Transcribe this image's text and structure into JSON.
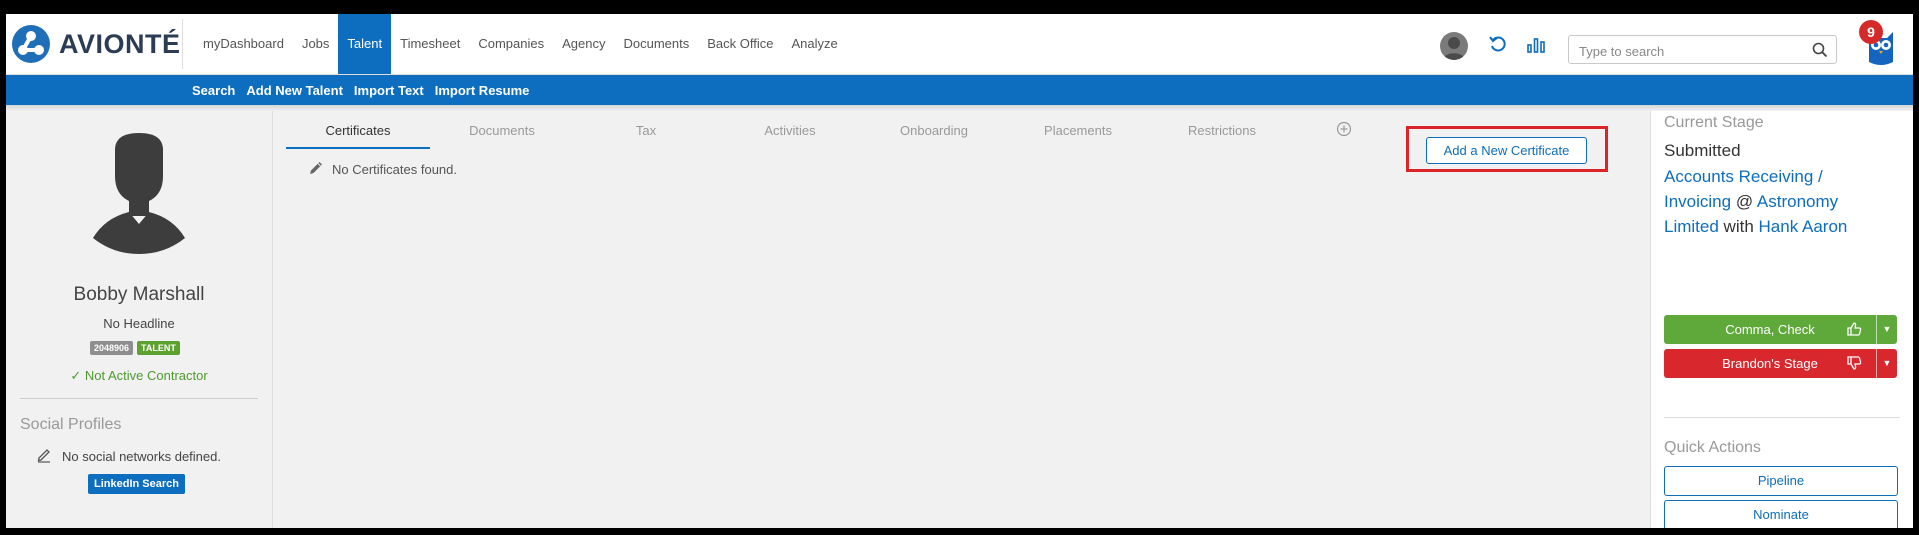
{
  "brand": {
    "name": "AVIONTÉ"
  },
  "nav": {
    "items": [
      {
        "label": "myDashboard"
      },
      {
        "label": "Jobs"
      },
      {
        "label": "Talent",
        "active": true
      },
      {
        "label": "Timesheet"
      },
      {
        "label": "Companies"
      },
      {
        "label": "Agency"
      },
      {
        "label": "Documents"
      },
      {
        "label": "Back Office"
      },
      {
        "label": "Analyze"
      }
    ]
  },
  "search": {
    "placeholder": "Type to search"
  },
  "notifications": {
    "count": "9"
  },
  "subnav": {
    "items": [
      {
        "label": "Search"
      },
      {
        "label": "Add New Talent"
      },
      {
        "label": "Import Text"
      },
      {
        "label": "Import Resume"
      }
    ]
  },
  "profile": {
    "name": "Bobby Marshall",
    "headline": "No Headline",
    "id_badge": "2048906",
    "type_badge": "TALENT",
    "contractor_status": "Not Active Contractor"
  },
  "social": {
    "title": "Social Profiles",
    "empty_text": "No social networks defined.",
    "linkedin_button": "LinkedIn Search"
  },
  "tabs": {
    "items": [
      {
        "label": "Certificates",
        "active": true
      },
      {
        "label": "Documents"
      },
      {
        "label": "Tax"
      },
      {
        "label": "Activities"
      },
      {
        "label": "Onboarding"
      },
      {
        "label": "Placements"
      },
      {
        "label": "Restrictions"
      }
    ]
  },
  "certificates": {
    "empty_text": "No Certificates found.",
    "add_button": "Add a New Certificate"
  },
  "stage": {
    "title": "Current Stage",
    "status": "Submitted",
    "job": "Accounts Receiving / Invoicing",
    "at": "@",
    "company": "Astronomy Limited",
    "with": "with",
    "contact": "Hank Aaron",
    "advance_button": "Comma, Check",
    "reject_button": "Brandon's Stage"
  },
  "quick_actions": {
    "title": "Quick Actions",
    "items": [
      {
        "label": "Pipeline"
      },
      {
        "label": "Nominate"
      }
    ]
  },
  "colors": {
    "brand_blue": "#0d6dbe",
    "success_green": "#5fa83a",
    "danger_red": "#d9272e",
    "highlight_red": "#d9252a"
  }
}
